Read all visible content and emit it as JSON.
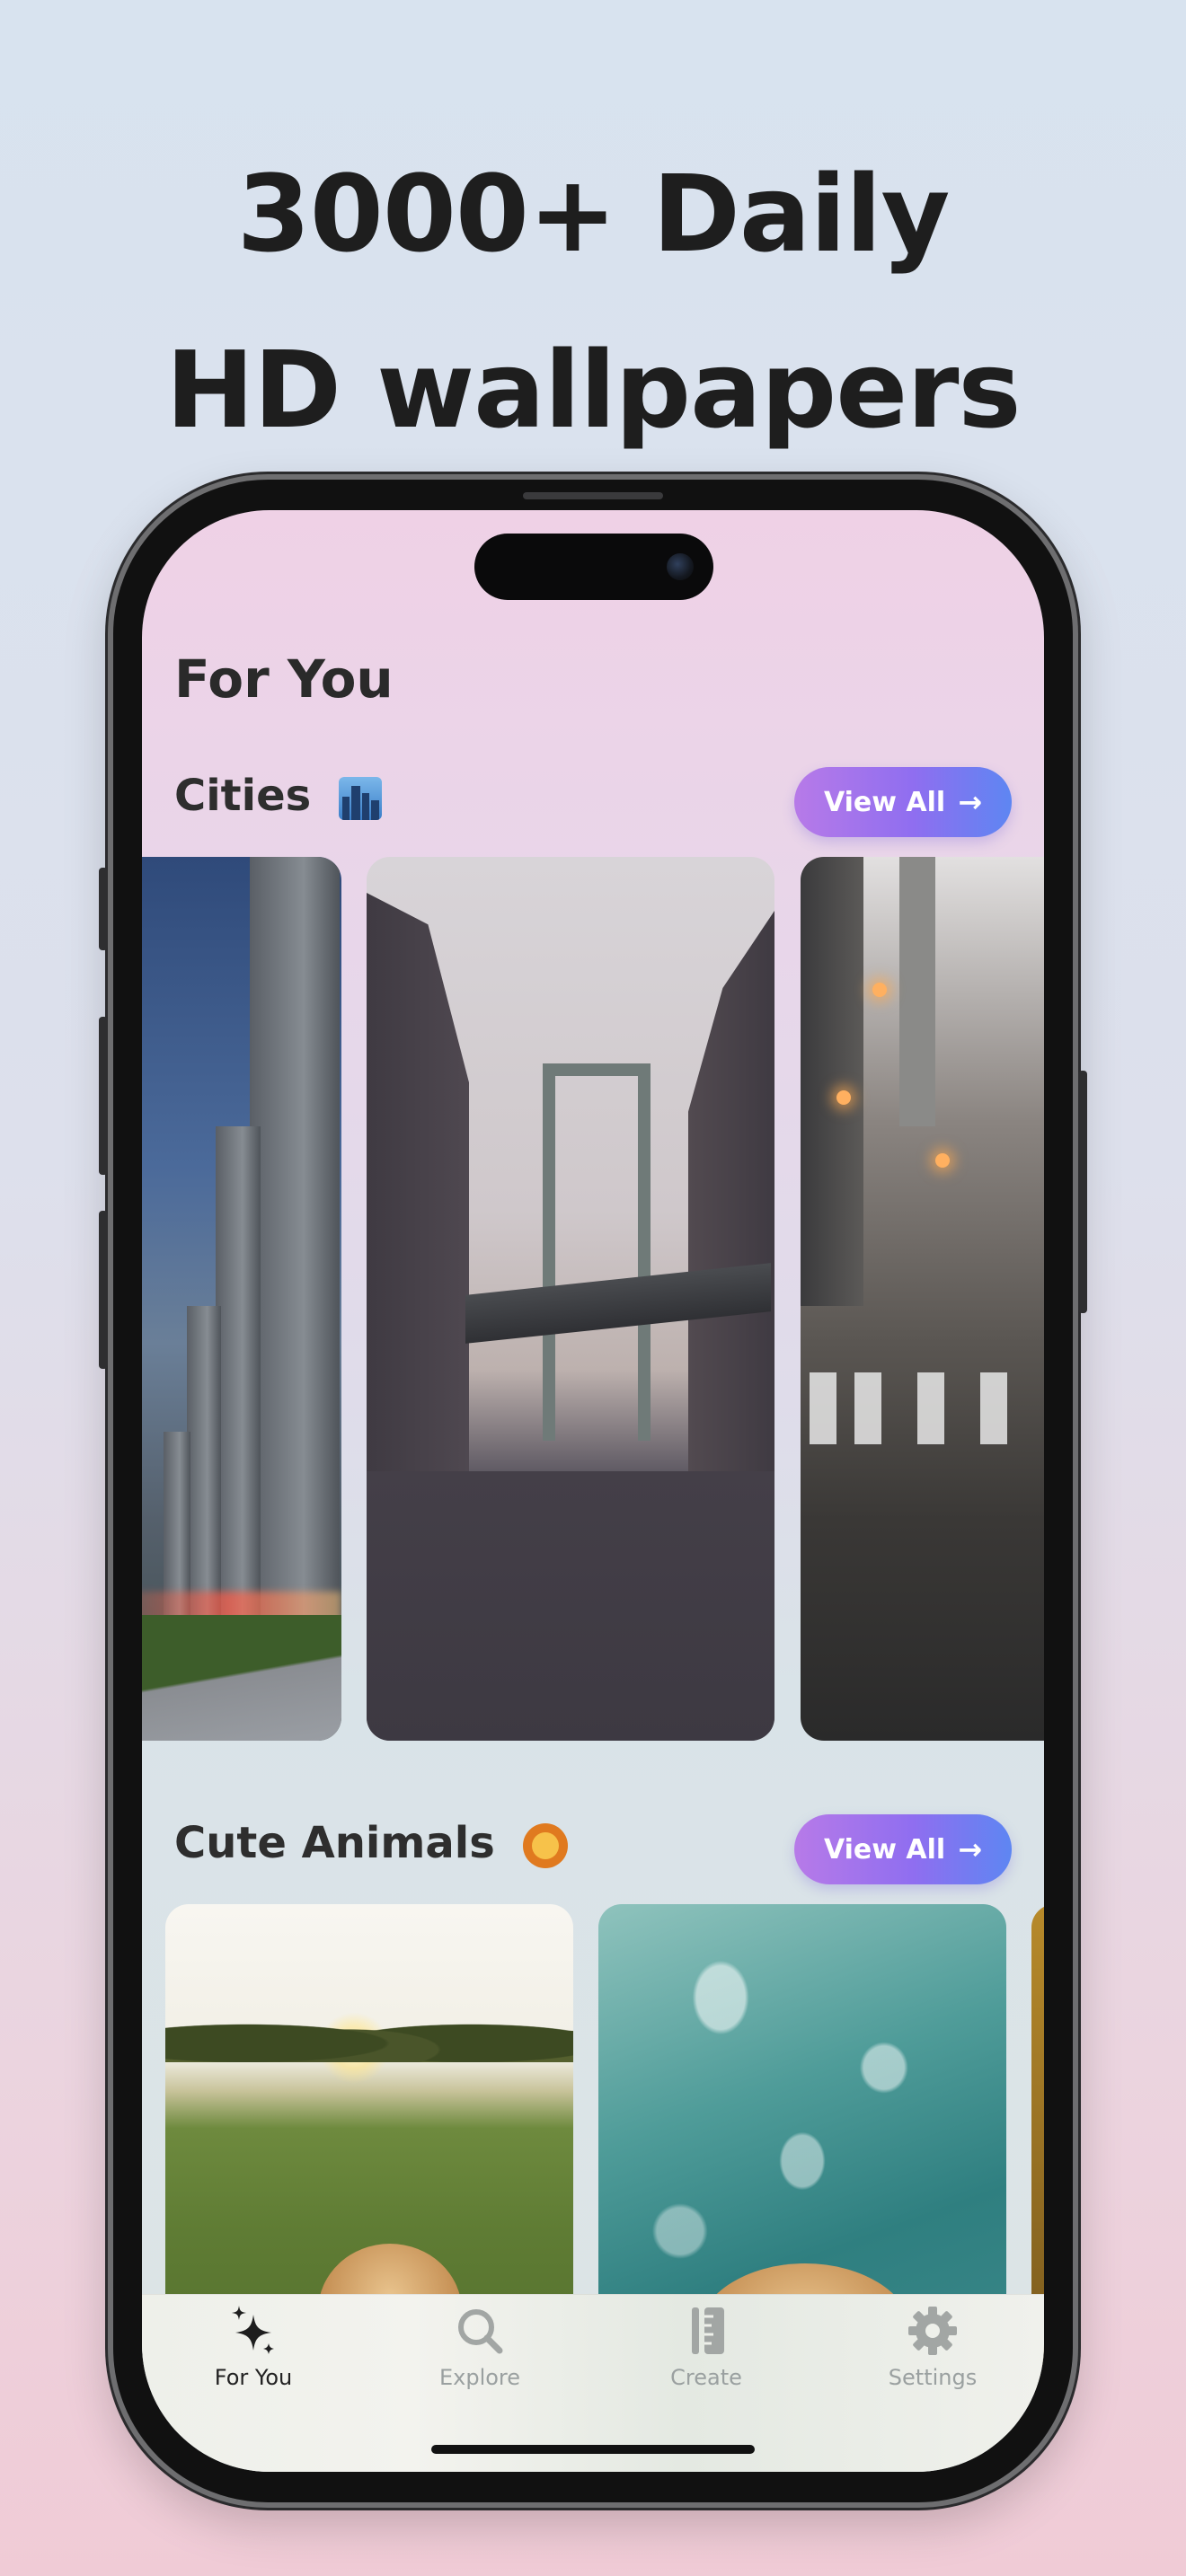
{
  "headline": {
    "line1": "3000+ Daily",
    "line2": "HD wallpapers"
  },
  "screen": {
    "page_title": "For You",
    "sections": [
      {
        "title": "Cities",
        "emoji": "cityscape-emoji",
        "view_all_label": "View All",
        "arrow": "→"
      },
      {
        "title": "Cute Animals",
        "emoji": "lion-emoji",
        "view_all_label": "View All",
        "arrow": "→"
      }
    ],
    "tabbar": {
      "tabs": [
        {
          "label": "For You",
          "icon": "sparkles-icon",
          "active": true
        },
        {
          "label": "Explore",
          "icon": "magnifier-icon",
          "active": false
        },
        {
          "label": "Create",
          "icon": "ruler-pencil-icon",
          "active": false
        },
        {
          "label": "Settings",
          "icon": "gear-icon",
          "active": false
        }
      ]
    }
  },
  "colors": {
    "view_all_gradient": [
      "#b77ae8",
      "#5e86f2"
    ],
    "headline": "#1e1e1e"
  }
}
